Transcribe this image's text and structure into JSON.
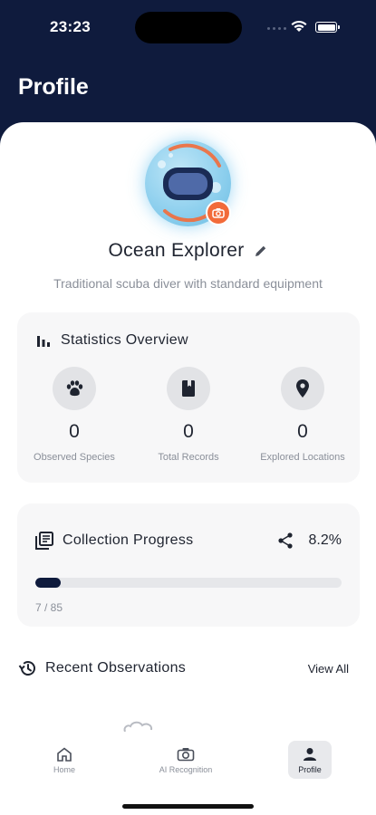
{
  "status_bar": {
    "time": "23:23"
  },
  "header": {
    "title": "Profile"
  },
  "profile": {
    "name": "Ocean Explorer",
    "bio": "Traditional scuba diver with standard equipment"
  },
  "stats": {
    "title": "Statistics Overview",
    "items": [
      {
        "icon": "paw-icon",
        "value": "0",
        "label": "Observed Species"
      },
      {
        "icon": "book-icon",
        "value": "0",
        "label": "Total Records"
      },
      {
        "icon": "location-pin-icon",
        "value": "0",
        "label": "Explored Locations"
      }
    ]
  },
  "collection": {
    "title": "Collection Progress",
    "percent_label": "8.2%",
    "progress": 0.082,
    "count_label": "7 / 85"
  },
  "recent": {
    "title": "Recent Observations",
    "view_all": "View All"
  },
  "nav": {
    "items": [
      {
        "label": "Home",
        "icon": "home-icon",
        "active": false
      },
      {
        "label": "AI Recognition",
        "icon": "camera-icon",
        "active": false
      },
      {
        "label": "Profile",
        "icon": "person-icon",
        "active": true
      }
    ]
  },
  "colors": {
    "primary": "#0f1b3d",
    "accent": "#f26b3a"
  }
}
